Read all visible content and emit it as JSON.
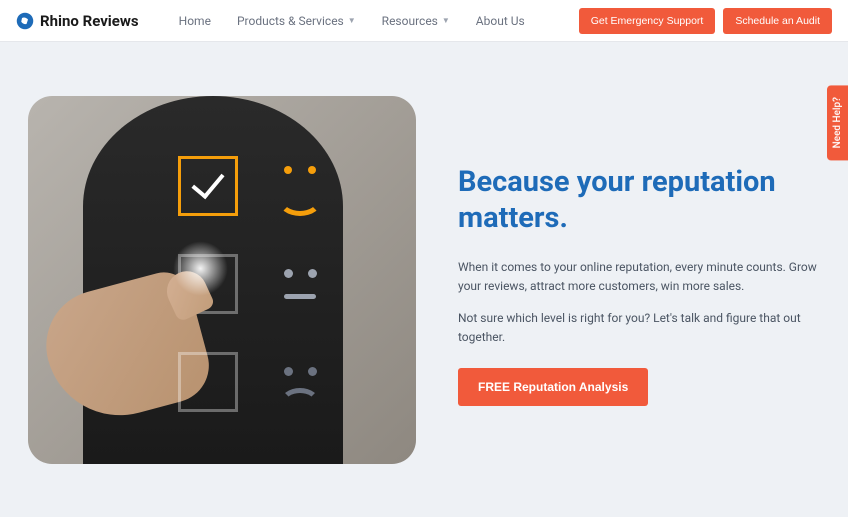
{
  "brand": "Rhino Reviews",
  "nav": {
    "items": [
      "Home",
      "Products & Services",
      "Resources",
      "About Us"
    ],
    "btn1": "Get Emergency Support",
    "btn2": "Schedule an Audit"
  },
  "hero": {
    "headline": "Because your reputation matters.",
    "p1": "When it comes to your online reputation, every minute counts. Grow your reviews, attract more customers, win more sales.",
    "p2": "Not sure which level is right for you? Let's talk and figure that out together.",
    "cta": "FREE Reputation Analysis"
  },
  "help_tab": "Need Help?",
  "colors": {
    "accent": "#f15a3b",
    "primary": "#1e6bb8"
  }
}
